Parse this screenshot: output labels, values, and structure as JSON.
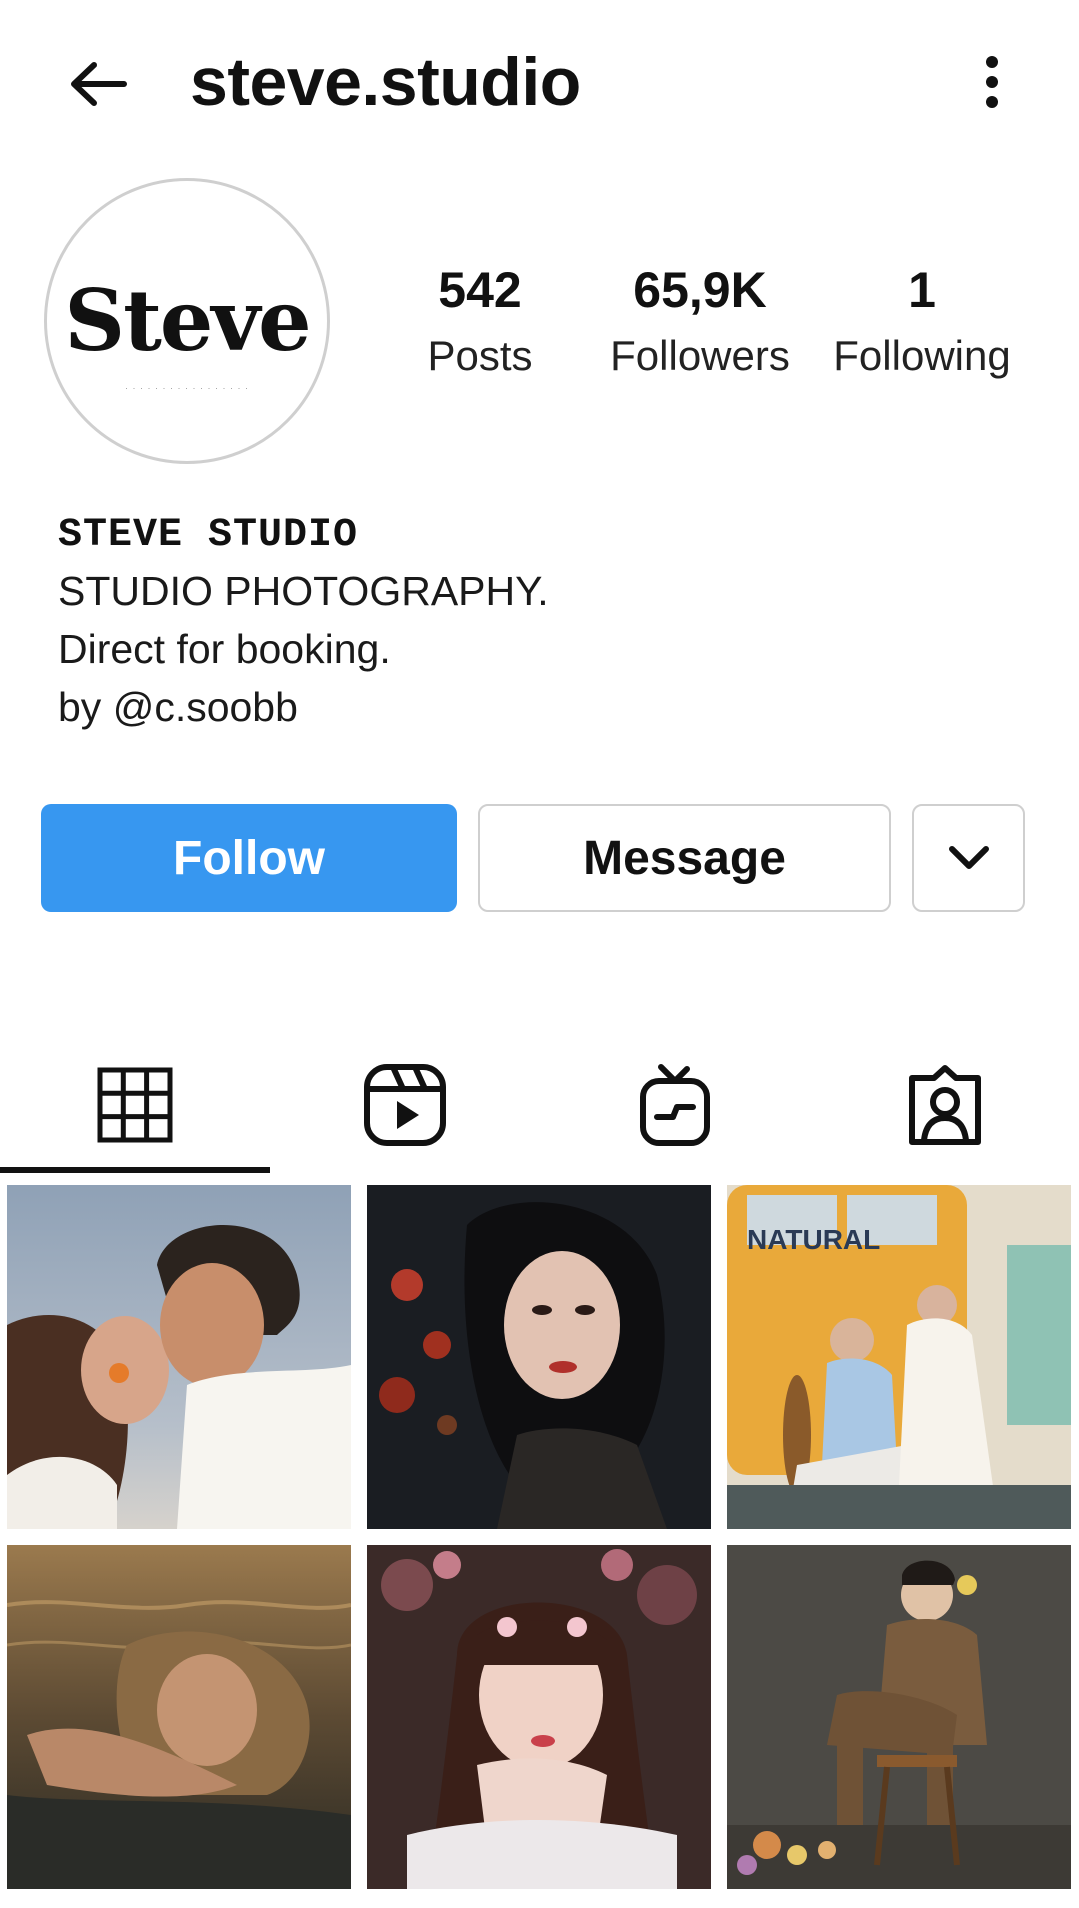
{
  "header": {
    "username": "steve.studio",
    "back_icon": "arrow-left-icon",
    "more_icon": "more-vertical-icon"
  },
  "profile": {
    "avatar_logo_text": "Steve",
    "stats": {
      "posts_count": "542",
      "posts_label": "Posts",
      "followers_count": "65,9K",
      "followers_label": "Followers",
      "following_count": "1",
      "following_label": "Following"
    }
  },
  "bio": {
    "name": "STEVE STUDIO",
    "line1": "STUDIO PHOTOGRAPHY.",
    "line2": "Direct for booking.",
    "line3": "by @c.soobb"
  },
  "actions": {
    "follow_label": "Follow",
    "message_label": "Message",
    "more_icon": "chevron-down-icon",
    "follow_color": "#3797f0"
  },
  "tabs": [
    {
      "icon": "grid-icon",
      "selected": true
    },
    {
      "icon": "reels-icon",
      "selected": false
    },
    {
      "icon": "igtv-icon",
      "selected": false
    },
    {
      "icon": "tagged-icon",
      "selected": false
    }
  ],
  "posts": [
    {
      "icon": "photo-couple-beach"
    },
    {
      "icon": "photo-woman-dark-portrait"
    },
    {
      "icon": "photo-natural-magazine-cover",
      "overlay_text": "NATURAL"
    },
    {
      "icon": "photo-woman-water"
    },
    {
      "icon": "photo-girl-flowers"
    },
    {
      "icon": "photo-man-chair"
    }
  ]
}
